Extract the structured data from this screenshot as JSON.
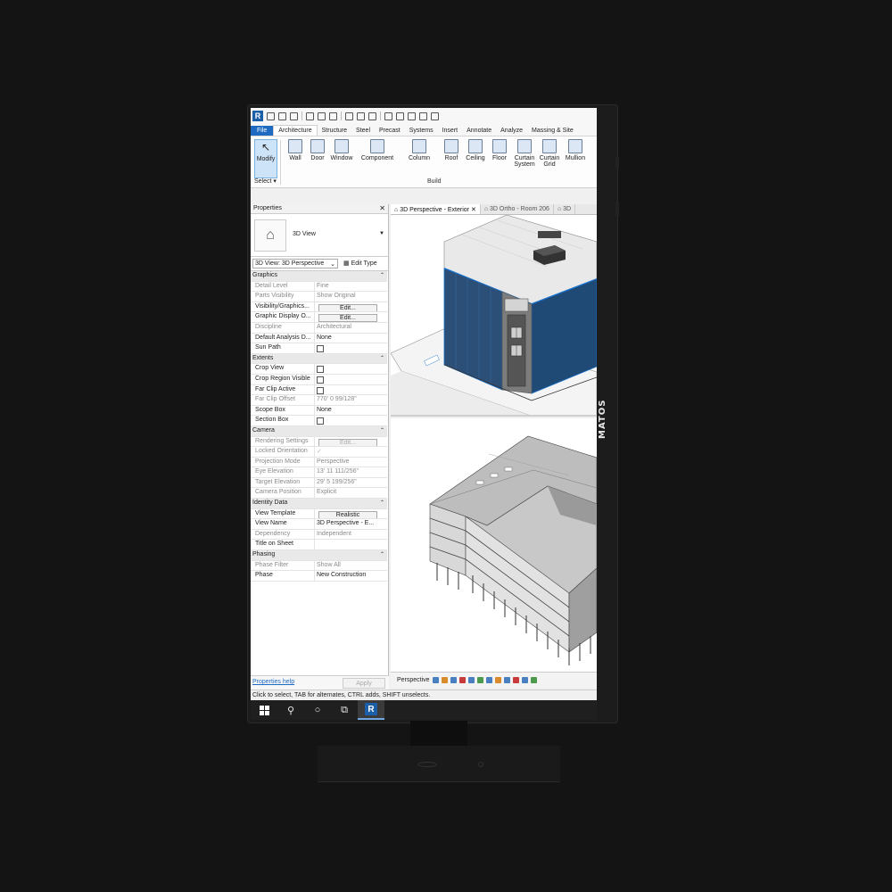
{
  "monitor": {
    "brand": "MATOS"
  },
  "qat": {
    "app_logo": "R"
  },
  "tabs": [
    "File",
    "Architecture",
    "Structure",
    "Steel",
    "Precast",
    "Systems",
    "Insert",
    "Annotate",
    "Analyze",
    "Massing & Site"
  ],
  "ribbon": {
    "modify": "Modify",
    "select": "Select",
    "build": "Build",
    "tools": {
      "wall": "Wall",
      "door": "Door",
      "window": "Window",
      "component": "Component",
      "column": "Column",
      "roof": "Roof",
      "ceiling": "Ceiling",
      "floor": "Floor",
      "curtain_system_1": "Curtain",
      "curtain_system_2": "System",
      "curtain_grid_1": "Curtain",
      "curtain_grid_2": "Grid",
      "mullion": "Mullion"
    }
  },
  "properties": {
    "title": "Properties",
    "type_name": "3D View",
    "selector": "3D View: 3D Perspective",
    "edit_type": "Edit Type",
    "help_link": "Properties help",
    "apply": "Apply",
    "sections": {
      "graphics": "Graphics",
      "extents": "Extents",
      "camera": "Camera",
      "identity": "Identity Data",
      "phasing": "Phasing"
    },
    "graphics": {
      "detail_level_k": "Detail Level",
      "detail_level_v": "Fine",
      "parts_visibility_k": "Parts Visibility",
      "parts_visibility_v": "Show Original",
      "vis_graphics_k": "Visibility/Graphics...",
      "edit": "Edit...",
      "graphic_display_k": "Graphic Display O...",
      "discipline_k": "Discipline",
      "discipline_v": "Architectural",
      "default_analysis_k": "Default Analysis D...",
      "default_analysis_v": "None",
      "sun_path_k": "Sun Path"
    },
    "extents": {
      "crop_view_k": "Crop View",
      "crop_region_k": "Crop Region Visible",
      "far_clip_active_k": "Far Clip Active",
      "far_clip_offset_k": "Far Clip Offset",
      "far_clip_offset_v": "770'  0 99/128\"",
      "scope_box_k": "Scope Box",
      "scope_box_v": "None",
      "section_box_k": "Section Box"
    },
    "camera": {
      "rendering_k": "Rendering Settings",
      "rendering_v": "Edit...",
      "locked_k": "Locked Orientation",
      "projection_k": "Projection Mode",
      "projection_v": "Perspective",
      "eye_k": "Eye Elevation",
      "eye_v": "13'  11 111/256\"",
      "target_k": "Target Elevation",
      "target_v": "29'  5 199/256\"",
      "position_k": "Camera Position",
      "position_v": "Explicit"
    },
    "identity": {
      "template_k": "View Template",
      "template_v": "Realistic",
      "view_name_k": "View Name",
      "view_name_v": "3D Perspective - E...",
      "dependency_k": "Dependency",
      "dependency_v": "Independent",
      "title_sheet_k": "Title on Sheet"
    },
    "phasing": {
      "filter_k": "Phase Filter",
      "filter_v": "Show All",
      "phase_k": "Phase",
      "phase_v": "New Construction"
    }
  },
  "view_tabs": [
    "3D Perspective - Exterior",
    "3D Ortho - Room 206",
    "3D"
  ],
  "view_bar": {
    "mode": "Perspective"
  },
  "status_bar": "Click to select, TAB for alternates, CTRL adds, SHIFT unselects.",
  "taskbar": {
    "revit": "R"
  }
}
